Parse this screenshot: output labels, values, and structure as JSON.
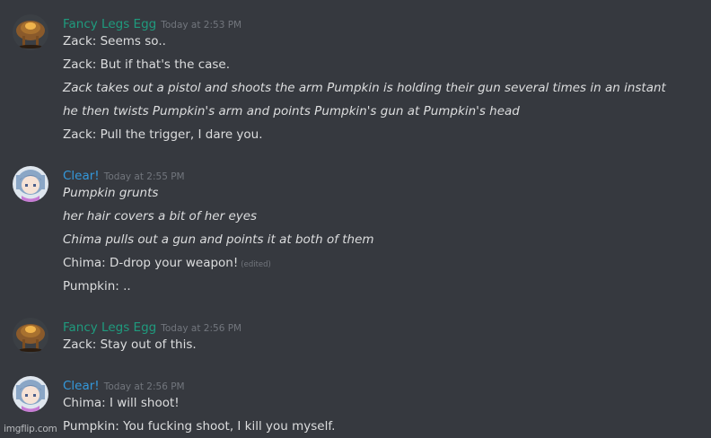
{
  "messages": [
    {
      "author": "Fancy Legs Egg",
      "author_color": "#1f9b7e",
      "avatar": "egg-avatar",
      "timestamp": "Today at 2:53 PM",
      "lines": [
        {
          "text": "Zack: Seems so..",
          "italic": false
        },
        {
          "text": "Zack: But if that's the case.",
          "italic": false
        },
        {
          "text": "Zack takes out a pistol and shoots the arm Pumpkin is holding their gun several times in an instant",
          "italic": true
        },
        {
          "text": "he then twists Pumpkin's arm and points Pumpkin's gun at Pumpkin's head",
          "italic": true
        },
        {
          "text": "Zack: Pull the trigger, I dare you.",
          "italic": false
        }
      ]
    },
    {
      "author": "Clear!",
      "author_color": "#3498db",
      "avatar": "anime-avatar",
      "timestamp": "Today at 2:55 PM",
      "lines": [
        {
          "text": "Pumpkin grunts",
          "italic": true
        },
        {
          "text": "her hair covers a bit of her eyes",
          "italic": true
        },
        {
          "text": "Chima pulls out a gun and points it at both of them",
          "italic": true
        },
        {
          "text": "Chima: D-drop your weapon!",
          "italic": false,
          "edited": "(edited)"
        },
        {
          "text": "Pumpkin: ..",
          "italic": false
        }
      ]
    },
    {
      "author": "Fancy Legs Egg",
      "author_color": "#1f9b7e",
      "avatar": "egg-avatar",
      "timestamp": "Today at 2:56 PM",
      "lines": [
        {
          "text": "Zack: Stay out of this.",
          "italic": false
        }
      ]
    },
    {
      "author": "Clear!",
      "author_color": "#3498db",
      "avatar": "anime-avatar",
      "timestamp": "Today at 2:56 PM",
      "lines": [
        {
          "text": "Chima: I will shoot!",
          "italic": false
        },
        {
          "text": "Pumpkin: You fucking shoot, I kill you myself.",
          "italic": false
        }
      ]
    }
  ],
  "watermark": "imgflip.com"
}
